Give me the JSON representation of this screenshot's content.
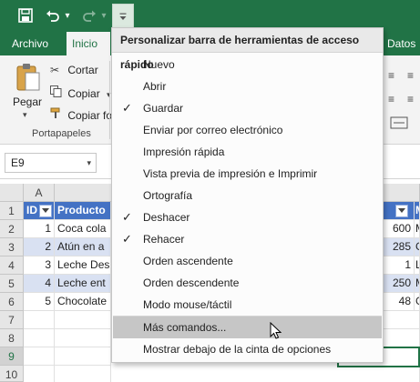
{
  "ribbon": {
    "tabs": [
      "Archivo",
      "Inicio",
      "Datos"
    ],
    "paste_label": "Pegar",
    "cut_label": "Cortar",
    "copy_label": "Copiar",
    "format_painter_label": "Copiar fo",
    "clipboard_group": "Portapapeles",
    "dropdown_glyph": "▾"
  },
  "namebox": {
    "value": "E9"
  },
  "grid": {
    "columns": [
      "A"
    ],
    "rows": [
      "1",
      "2",
      "3",
      "4",
      "5",
      "6",
      "7",
      "8",
      "9",
      "10"
    ],
    "header": {
      "id": "ID",
      "producto": "Producto"
    },
    "data": [
      {
        "id": "1",
        "producto": "Coca cola",
        "right_num": "600",
        "right_letter": "M"
      },
      {
        "id": "2",
        "producto": "Atún en a",
        "right_num": "285",
        "right_letter": "G"
      },
      {
        "id": "3",
        "producto": "Leche Des",
        "right_num": "1",
        "right_letter": "L"
      },
      {
        "id": "4",
        "producto": "Leche ent",
        "right_num": "250",
        "right_letter": "M"
      },
      {
        "id": "5",
        "producto": "Chocolate",
        "right_num": "48",
        "right_letter": "G"
      }
    ],
    "right_header_letter": "M"
  },
  "menu": {
    "title": "Personalizar barra de herramientas de acceso rápido",
    "items": [
      {
        "label": "Nuevo",
        "checked": false
      },
      {
        "label": "Abrir",
        "checked": false
      },
      {
        "label": "Guardar",
        "checked": true
      },
      {
        "label": "Enviar por correo electrónico",
        "checked": false
      },
      {
        "label": "Impresión rápida",
        "checked": false
      },
      {
        "label": "Vista previa de impresión e Imprimir",
        "checked": false
      },
      {
        "label": "Ortografía",
        "checked": false
      },
      {
        "label": "Deshacer",
        "checked": true
      },
      {
        "label": "Rehacer",
        "checked": true
      },
      {
        "label": "Orden ascendente",
        "checked": false
      },
      {
        "label": "Orden descendente",
        "checked": false
      },
      {
        "label": "Modo mouse/táctil",
        "checked": false
      }
    ],
    "more_commands": "Más comandos...",
    "show_below": "Mostrar debajo de la cinta de opciones",
    "check_glyph": "✓"
  },
  "colors": {
    "excel_green": "#217346",
    "table_header": "#4472c4",
    "table_band": "#d9e1f2"
  }
}
